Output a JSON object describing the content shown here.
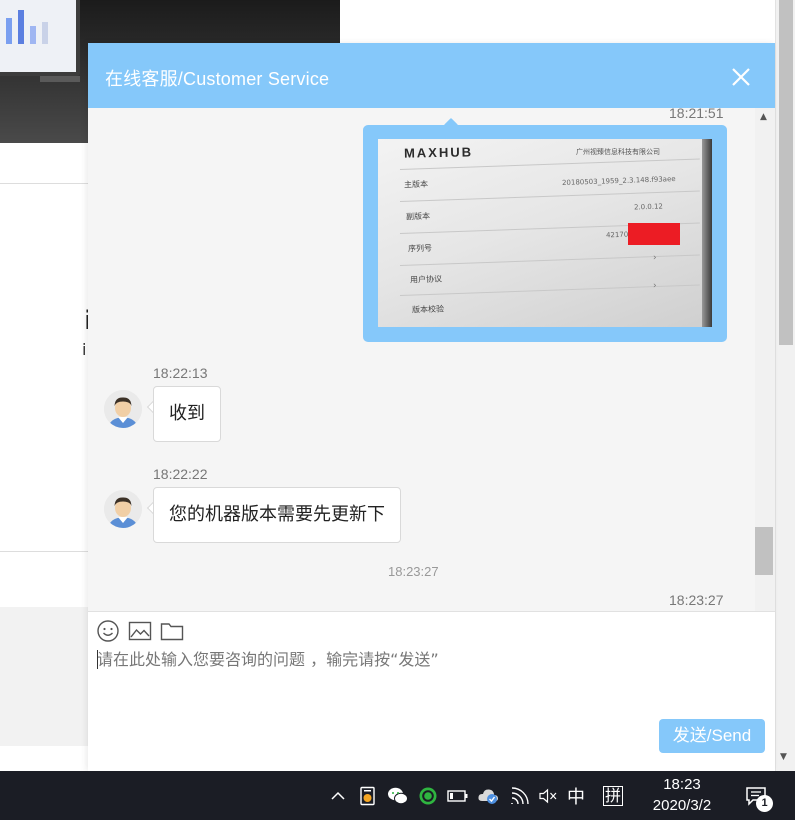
{
  "chat": {
    "title": "在线客服/Customer Service",
    "close_icon": "close-icon",
    "accent_color": "#85c8fa",
    "messages": [
      {
        "type": "timestamp_right",
        "text": "18:21:51"
      },
      {
        "type": "image",
        "sender": "user"
      },
      {
        "type": "timestamp_left",
        "text": "18:22:13"
      },
      {
        "type": "text",
        "sender": "agent",
        "text": "收到"
      },
      {
        "type": "timestamp_left",
        "text": "18:22:22"
      },
      {
        "type": "text",
        "sender": "agent",
        "text": "您的机器版本需要先更新下"
      },
      {
        "type": "timestamp_center",
        "text": "18:23:27"
      },
      {
        "type": "timestamp_right",
        "text": "18:23:27"
      }
    ],
    "image_message": {
      "brand": "MAXHUB",
      "company": "广州视臻信息科技有限公司",
      "rows": [
        {
          "label": "主版本",
          "value": "20180503_1959_2.3.148.f93aee"
        },
        {
          "label": "副版本",
          "value": "2.0.0.12"
        },
        {
          "label": "序列号",
          "value": "42170"
        },
        {
          "label": "用户协议",
          "value": "›"
        },
        {
          "label": "版本校验",
          "value": "›"
        }
      ],
      "redaction_color": "#ec1c24"
    },
    "composer": {
      "tools": [
        "emoji-icon",
        "image-icon",
        "folder-icon"
      ],
      "placeholder": "请在此处输入您要咨询的问题 ，输完请按“发送”",
      "value": "",
      "send_label": "发送/Send"
    }
  },
  "taskbar": {
    "tray_icons": [
      "chevron-up-icon",
      "app-icon",
      "wechat-icon",
      "360-icon",
      "battery-icon",
      "network-cloud-icon",
      "wifi-icon",
      "volume-muted-icon"
    ],
    "ime_mode": "中",
    "ime_name": "拼",
    "time": "18:23",
    "date": "2020/3/2",
    "notification_count": "1"
  }
}
